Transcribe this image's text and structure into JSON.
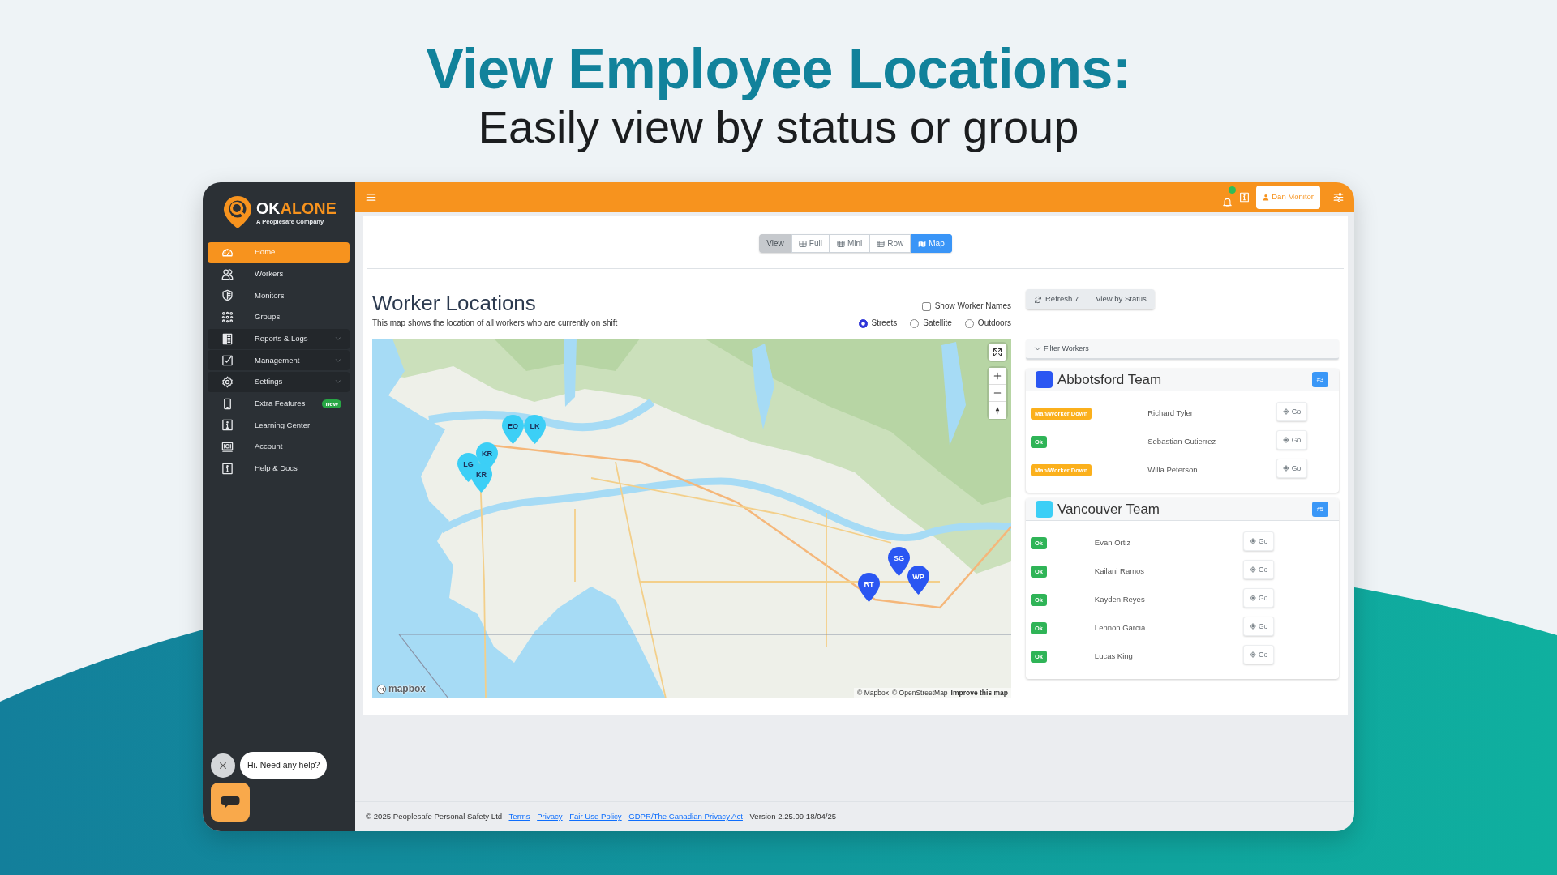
{
  "headline": {
    "title": "View Employee Locations:",
    "subtitle": "Easily view by status or group"
  },
  "sidebar": {
    "brand": {
      "wordmark": [
        {
          "text": "OK",
          "kind": "plain"
        },
        {
          "text": "ALONE",
          "kind": "accent"
        }
      ],
      "tagline": "A Peoplesafe Company"
    },
    "items": [
      {
        "label": "Home",
        "kind": "link",
        "selected": true
      },
      {
        "label": "Workers",
        "kind": "link",
        "selected": false
      },
      {
        "label": "Monitors",
        "kind": "link",
        "selected": false
      },
      {
        "label": "Groups",
        "kind": "link",
        "selected": false
      },
      {
        "label": "Reports & Logs",
        "kind": "menu",
        "selected": false
      },
      {
        "label": "Management",
        "kind": "menu",
        "selected": false
      },
      {
        "label": "Settings",
        "kind": "menu",
        "selected": false
      },
      {
        "label": "Extra Features",
        "kind": "link",
        "selected": false,
        "badge": "new"
      },
      {
        "label": "Learning Center",
        "kind": "link",
        "selected": false
      },
      {
        "label": "Account",
        "kind": "link",
        "selected": false
      },
      {
        "label": "Help & Docs",
        "kind": "link",
        "selected": false
      }
    ]
  },
  "chat": {
    "greeting": "Hi. Need any help?"
  },
  "topbar": {
    "notifications": true,
    "user": "Dan Monitor"
  },
  "view_switcher": {
    "label": "View",
    "modes": [
      {
        "label": "Full",
        "selected": false
      },
      {
        "label": "Mini",
        "selected": false
      },
      {
        "label": "Row",
        "selected": false
      },
      {
        "label": "Map",
        "selected": true
      }
    ]
  },
  "locations": {
    "title": "Worker Locations",
    "description": "This map shows the location of all workers who are currently on shift",
    "show_names": {
      "label": "Show Worker Names",
      "checked": false
    },
    "map_styles": [
      {
        "label": "Streets",
        "selected": true
      },
      {
        "label": "Satellite",
        "selected": false
      },
      {
        "label": "Outdoors",
        "selected": false
      }
    ],
    "map": {
      "pins": [
        {
          "label": "EO",
          "color": "#3ccff6"
        },
        {
          "label": "LK",
          "color": "#3ccff6"
        },
        {
          "label": "KR",
          "color": "#3ccff6"
        },
        {
          "label": "LG",
          "color": "#3ccff6"
        },
        {
          "label": "KR",
          "color": "#3ccff6"
        },
        {
          "label": "SG",
          "color": "#2a56f2"
        },
        {
          "label": "RT",
          "color": "#2a56f2"
        },
        {
          "label": "WP",
          "color": "#2a56f2"
        }
      ],
      "logo": "mapbox",
      "attribution": [
        "© Mapbox",
        "© OpenStreetMap",
        "Improve this map"
      ]
    }
  },
  "panel": {
    "refresh": "Refresh 7",
    "view_by_status": "View by Status",
    "filter": "Filter Workers",
    "groups": [
      {
        "name": "Abbotsford Team",
        "color": "#2a56f2",
        "count": "#3",
        "workers": [
          {
            "status": "Man/Worker Down",
            "color": "#fbb01c",
            "name": "Richard Tyler",
            "action": "Go"
          },
          {
            "status": "Ok",
            "color": "#2fb457",
            "name": "Sebastian Gutierrez",
            "action": "Go"
          },
          {
            "status": "Man/Worker Down",
            "color": "#fbb01c",
            "name": "Willa Peterson",
            "action": "Go"
          }
        ]
      },
      {
        "name": "Vancouver Team",
        "color": "#3ccff6",
        "count": "#5",
        "workers": [
          {
            "status": "Ok",
            "color": "#2fb457",
            "name": "Evan Ortiz",
            "action": "Go"
          },
          {
            "status": "Ok",
            "color": "#2fb457",
            "name": "Kailani Ramos",
            "action": "Go"
          },
          {
            "status": "Ok",
            "color": "#2fb457",
            "name": "Kayden Reyes",
            "action": "Go"
          },
          {
            "status": "Ok",
            "color": "#2fb457",
            "name": "Lennon Garcia",
            "action": "Go"
          },
          {
            "status": "Ok",
            "color": "#2fb457",
            "name": "Lucas King",
            "action": "Go"
          }
        ]
      }
    ]
  },
  "footer": {
    "copyright": "© 2025 Peoplesafe Personal Safety Ltd",
    "separator": "-",
    "links": [
      "Terms",
      "Privacy",
      "Fair Use Policy",
      "GDPR/The Canadian Privacy Act"
    ],
    "version": "Version 2.25.09 18/04/25"
  }
}
